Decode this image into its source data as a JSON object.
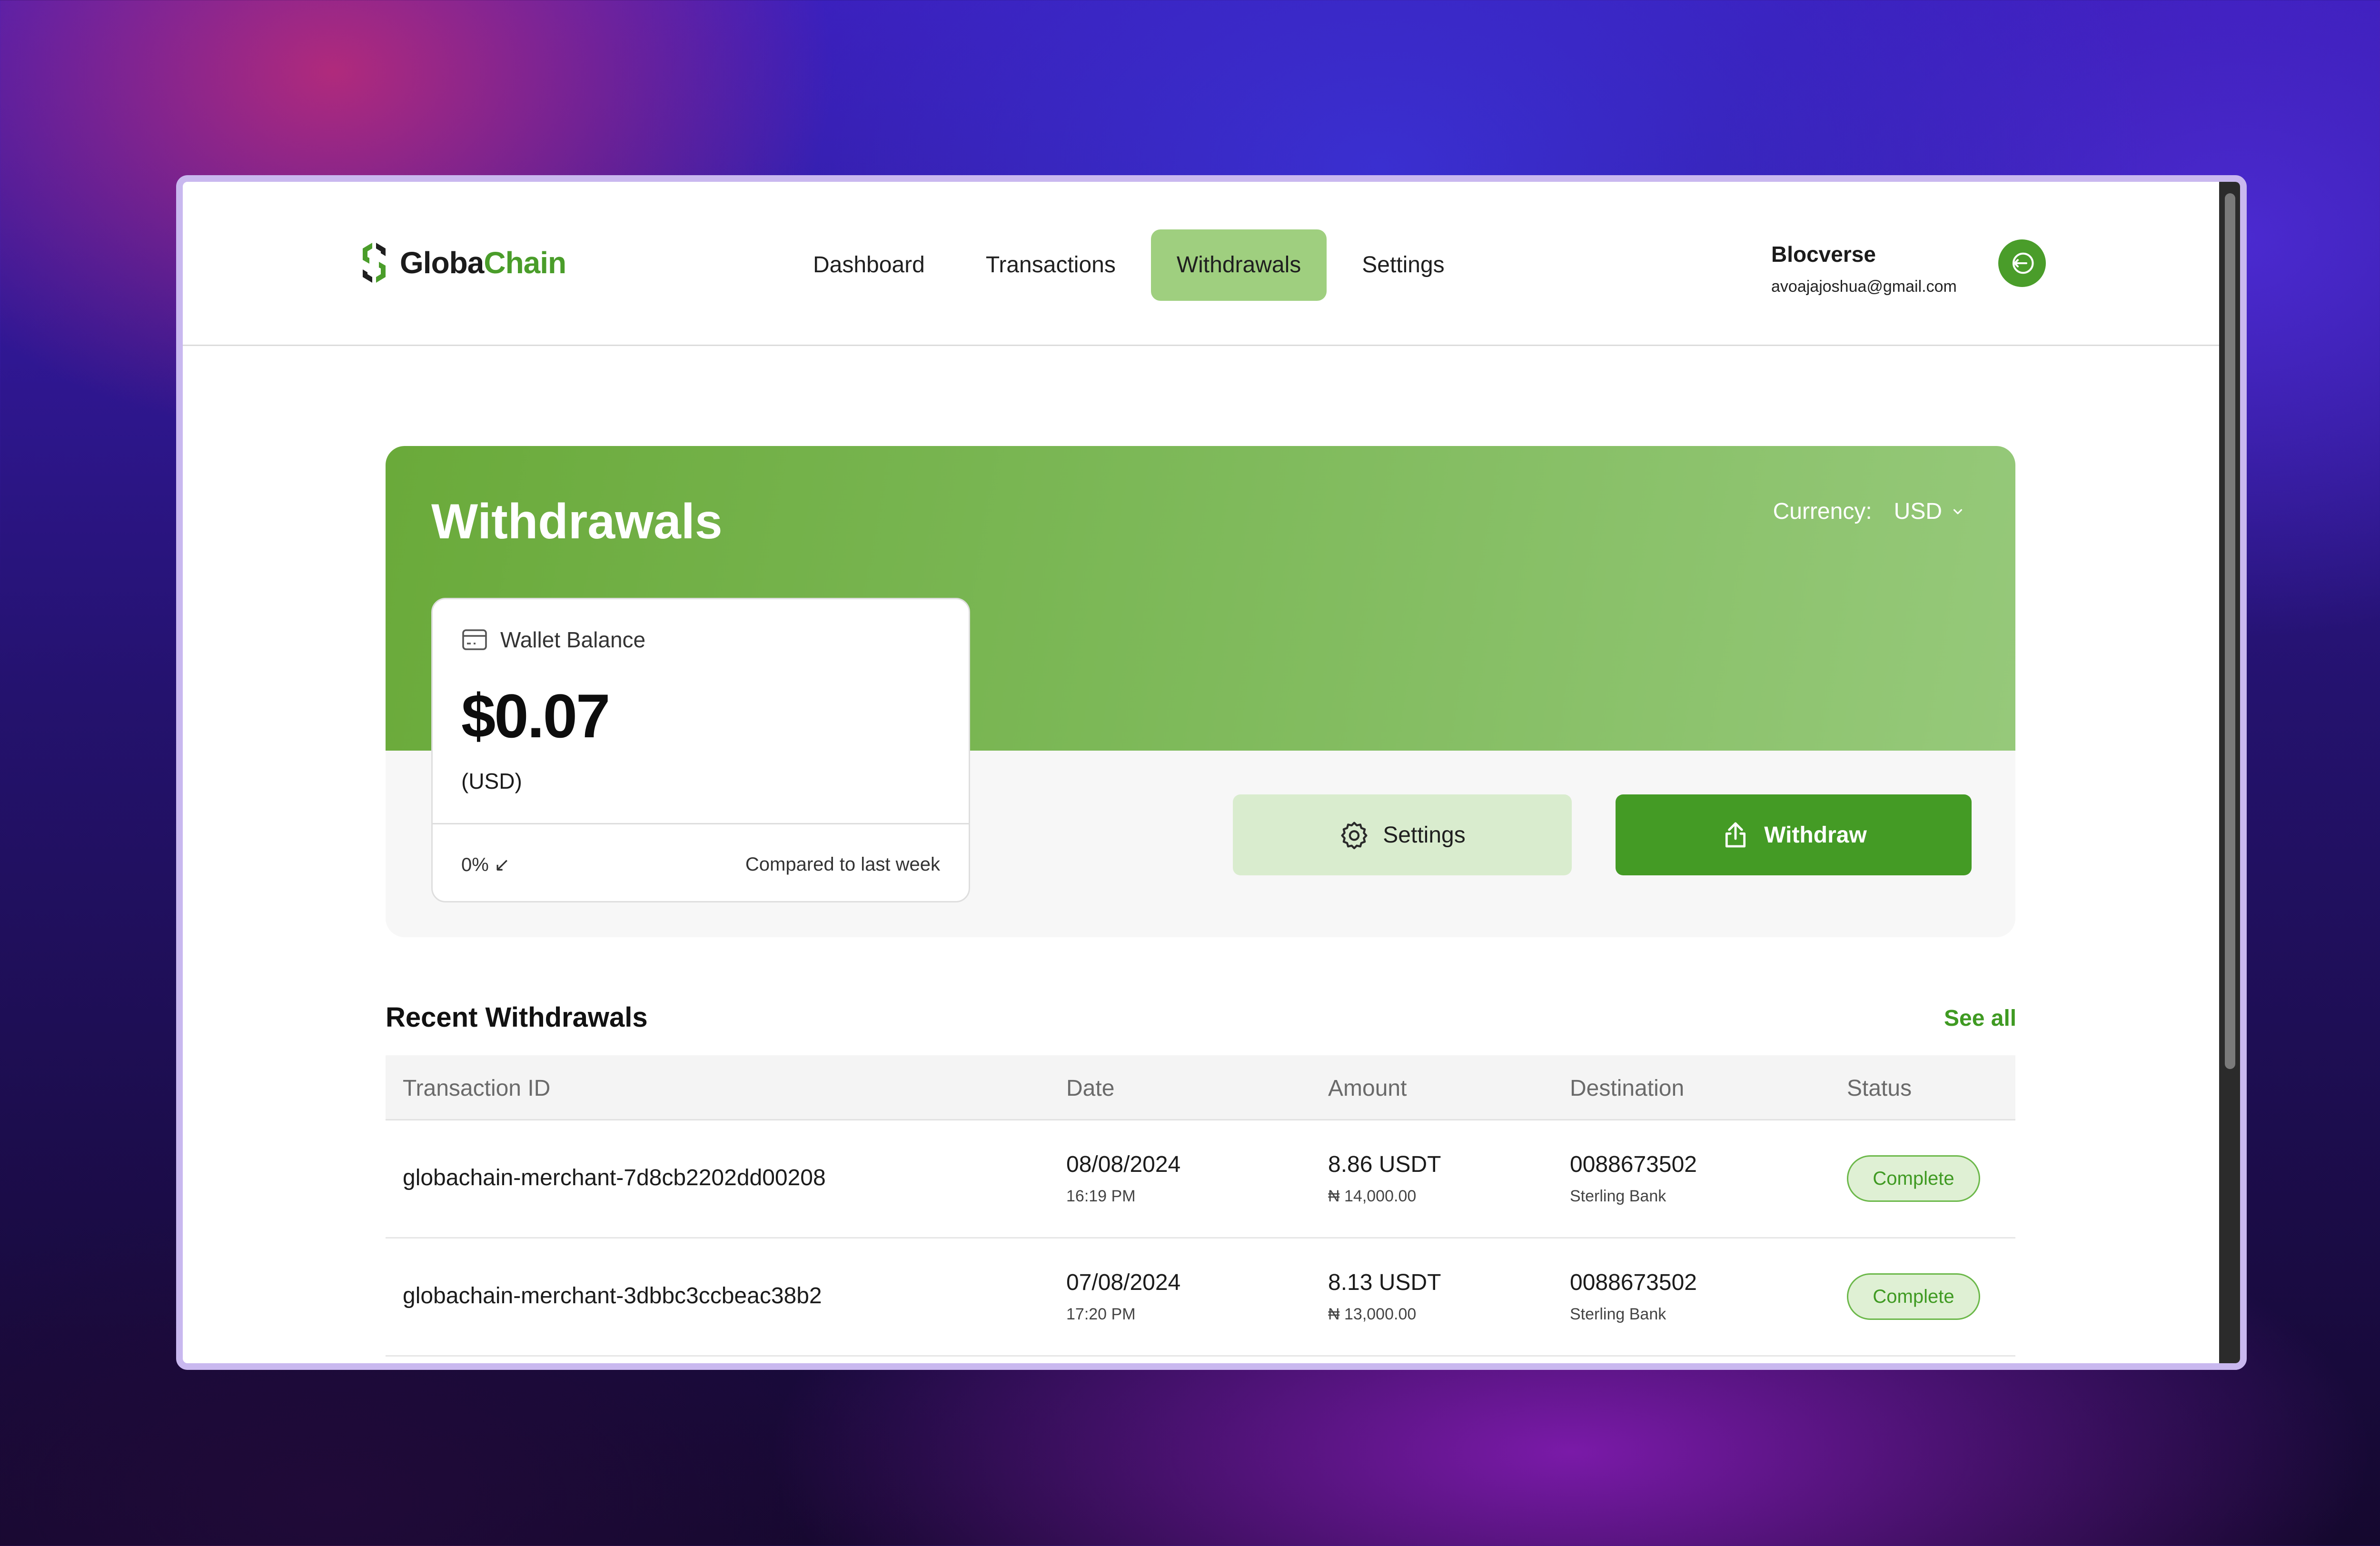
{
  "app": {
    "logo_text_main": "Globa",
    "logo_text_accent": "Chain",
    "brand_color": "#4a9d2a"
  },
  "nav": {
    "items": [
      {
        "label": "Dashboard",
        "active": false
      },
      {
        "label": "Transactions",
        "active": false
      },
      {
        "label": "Withdrawals",
        "active": true
      },
      {
        "label": "Settings",
        "active": false
      }
    ]
  },
  "user": {
    "name": "Blocverse",
    "email": "avoajajoshua@gmail.com",
    "logout_icon": "logout-icon"
  },
  "hero": {
    "title": "Withdrawals",
    "currency_label": "Currency:",
    "currency_value": "USD"
  },
  "wallet": {
    "label": "Wallet Balance",
    "amount": "$0.07",
    "unit": "(USD)",
    "change": "0% ↙",
    "compare_text": "Compared to last week"
  },
  "actions": {
    "settings_label": "Settings",
    "withdraw_label": "Withdraw"
  },
  "recent": {
    "title": "Recent Withdrawals",
    "see_all": "See all",
    "columns": [
      "Transaction ID",
      "Date",
      "Amount",
      "Destination",
      "Status"
    ],
    "rows": [
      {
        "id": "globachain-merchant-7d8cb2202dd00208",
        "date": "08/08/2024",
        "time": "16:19 PM",
        "amount": "8.86 USDT",
        "amount_ngn": "₦ 14,000.00",
        "account": "0088673502",
        "bank": "Sterling Bank",
        "status": "Complete"
      },
      {
        "id": "globachain-merchant-3dbbc3ccbeac38b2",
        "date": "07/08/2024",
        "time": "17:20 PM",
        "amount": "8.13 USDT",
        "amount_ngn": "₦ 13,000.00",
        "account": "0088673502",
        "bank": "Sterling Bank",
        "status": "Complete"
      }
    ]
  }
}
